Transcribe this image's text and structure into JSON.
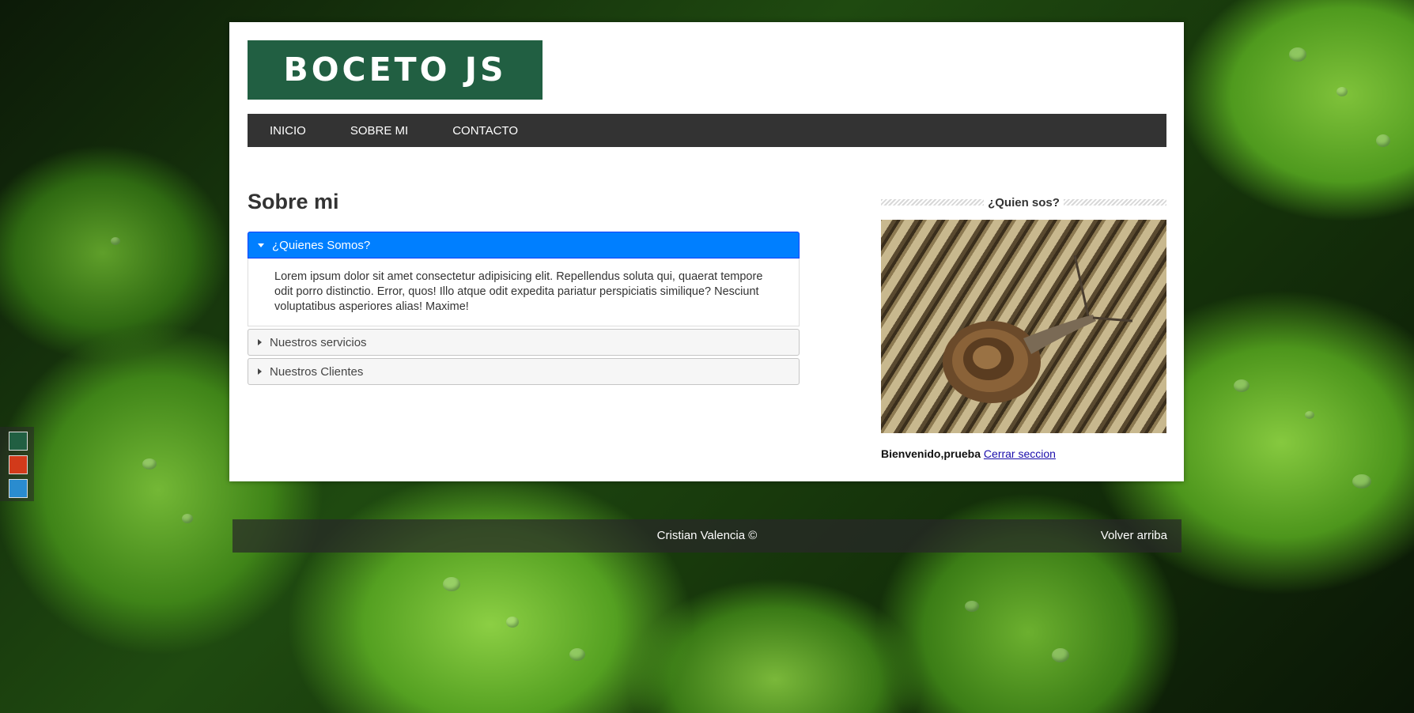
{
  "header": {
    "logo_text": "BOCETO JS"
  },
  "nav": {
    "items": [
      "INICIO",
      "SOBRE MI",
      "CONTACTO"
    ]
  },
  "main": {
    "title": "Sobre mi",
    "accordion": [
      {
        "label": "¿Quienes Somos?",
        "expanded": true,
        "content": "Lorem ipsum dolor sit amet consectetur adipisicing elit. Repellendus soluta qui, quaerat tempore odit porro distinctio. Error, quos! Illo atque odit expedita pariatur perspiciatis similique? Nesciunt voluptatibus asperiores alias! Maxime!"
      },
      {
        "label": "Nuestros servicios",
        "expanded": false
      },
      {
        "label": "Nuestros Clientes",
        "expanded": false
      }
    ]
  },
  "sidebar": {
    "title": "¿Quien sos?",
    "image_icon": "snail-photo",
    "welcome_text": "Bienvenido,prueba",
    "logout_link": "Cerrar seccion"
  },
  "theme_switcher": {
    "colors": [
      "#215f42",
      "#d23a1a",
      "#2a8ccf"
    ]
  },
  "footer": {
    "credit": "Cristian Valencia ©",
    "back_to_top": "Volver arriba"
  },
  "colors": {
    "logo_bg": "#215f42",
    "nav_bg": "#333333",
    "accordion_active": "#007fff"
  }
}
